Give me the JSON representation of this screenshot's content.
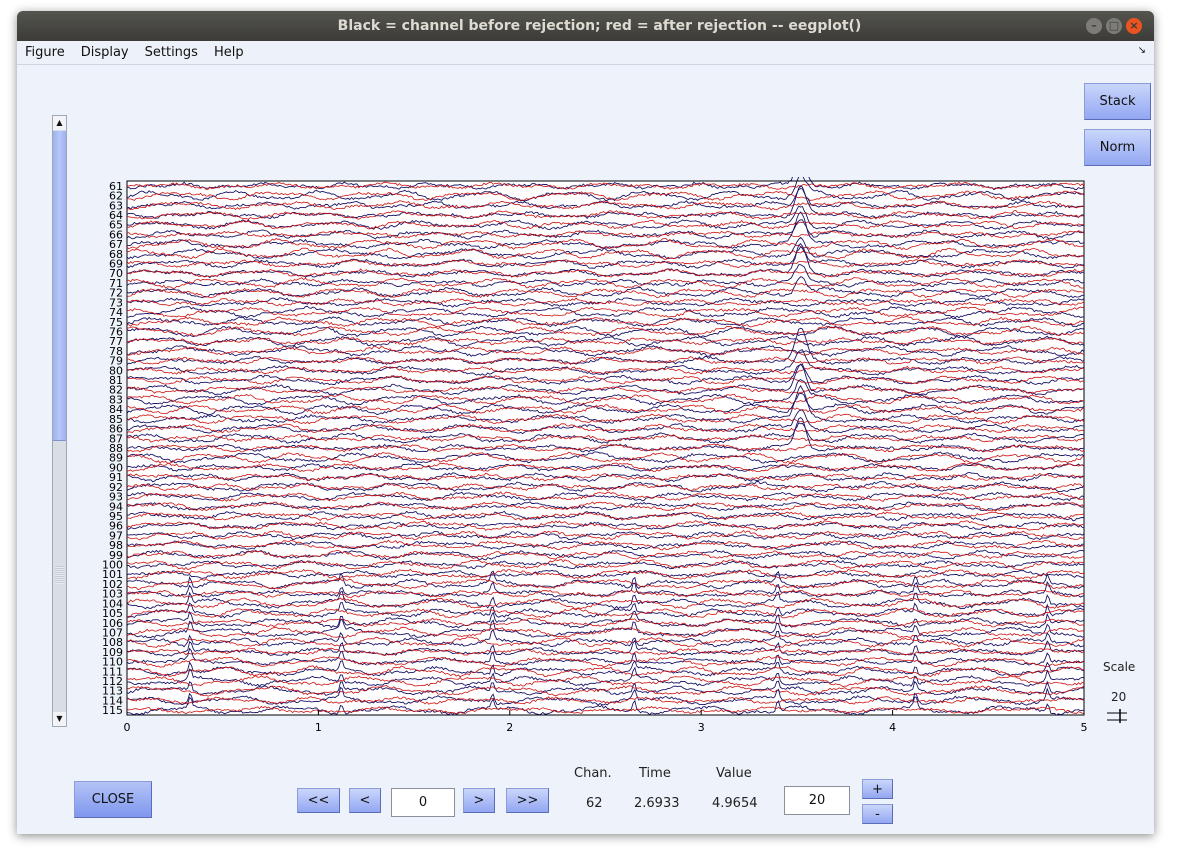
{
  "window": {
    "title": "Black = channel before rejection; red = after rejection -- eegplot()"
  },
  "menu": [
    "Figure",
    "Display",
    "Settings",
    "Help"
  ],
  "buttons": {
    "stack": "Stack",
    "norm": "Norm",
    "close": "CLOSE",
    "first": "<<",
    "prev": "<",
    "next": ">",
    "last": ">>",
    "plus": "+",
    "minus": "-"
  },
  "readout": {
    "chan_label": "Chan.",
    "time_label": "Time",
    "value_label": "Value",
    "chan_value": "62",
    "time_value": "2.6933",
    "value_value": "4.9654"
  },
  "inputs": {
    "time_position": "0",
    "scale_value": "20"
  },
  "scale": {
    "label": "Scale",
    "value": "20"
  },
  "chart_data": {
    "type": "line",
    "channels": [
      "61",
      "62",
      "63",
      "64",
      "65",
      "66",
      "67",
      "68",
      "69",
      "70",
      "71",
      "72",
      "73",
      "74",
      "75",
      "76",
      "77",
      "78",
      "79",
      "80",
      "81",
      "82",
      "83",
      "84",
      "85",
      "86",
      "87",
      "88",
      "89",
      "90",
      "91",
      "92",
      "93",
      "94",
      "95",
      "96",
      "97",
      "98",
      "99",
      "100",
      "101",
      "102",
      "103",
      "104",
      "105",
      "106",
      "107",
      "108",
      "109",
      "110",
      "111",
      "112",
      "113",
      "114",
      "115"
    ],
    "xlim": [
      0,
      5
    ],
    "x_ticks": [
      "0",
      "1",
      "2",
      "3",
      "4",
      "5"
    ],
    "series": [
      {
        "name": "Black = channel before rejection",
        "color": "#1a1466"
      },
      {
        "name": "red = after rejection",
        "color": "#cc1111"
      }
    ]
  }
}
